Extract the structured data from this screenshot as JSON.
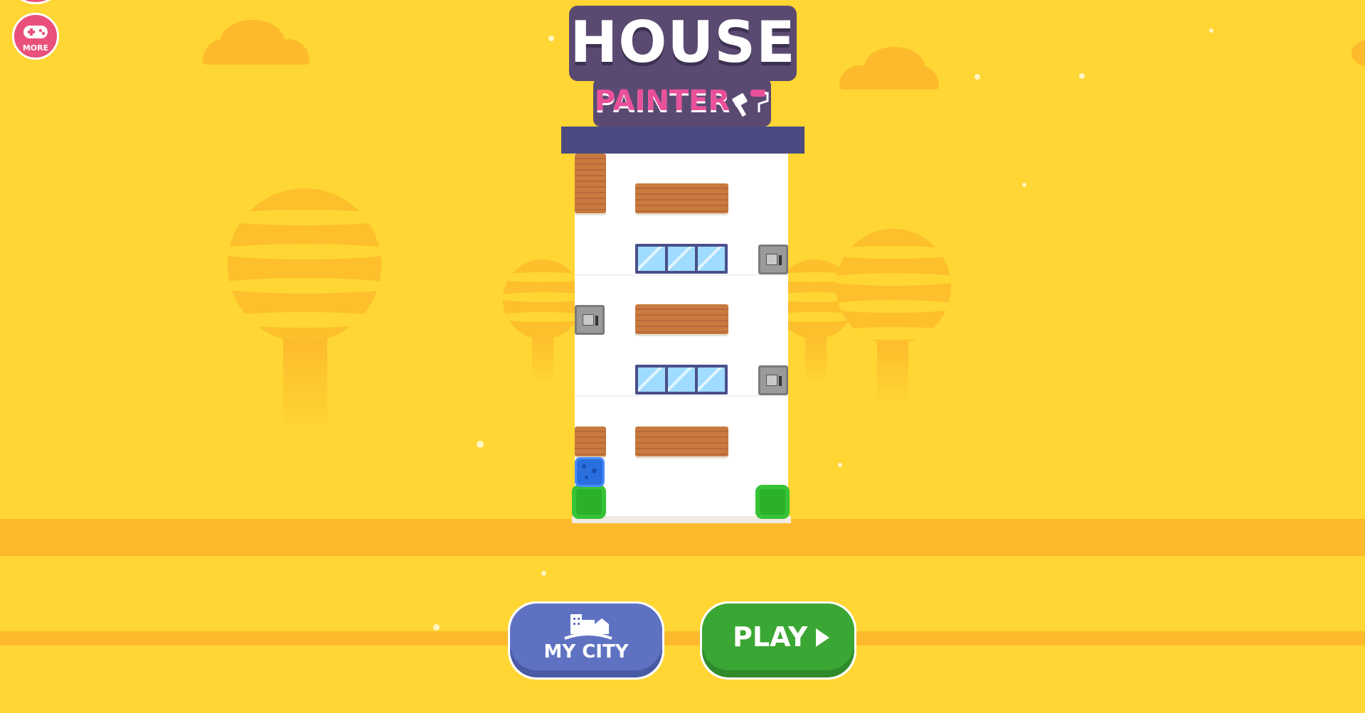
{
  "game": {
    "title_line1": "HOUSE",
    "title_line2": "PAINTER"
  },
  "buttons": {
    "more_label": "MORE",
    "my_city_label": "MY CITY",
    "play_label": "PLAY"
  },
  "icons": {
    "more": "gamepad-icon",
    "my_city": "city-icon",
    "play": "play-triangle-icon",
    "logo_tools": "paint-roller-brush-icon"
  },
  "colors": {
    "background": "#ffd633",
    "ground": "#fdb92c",
    "building_roof": "#4a4a80",
    "my_city_button": "#5f72c2",
    "play_button": "#3aa633",
    "more_button": "#e9507a",
    "painter_text": "#e9509a",
    "player_block": "#2a6fe0"
  }
}
